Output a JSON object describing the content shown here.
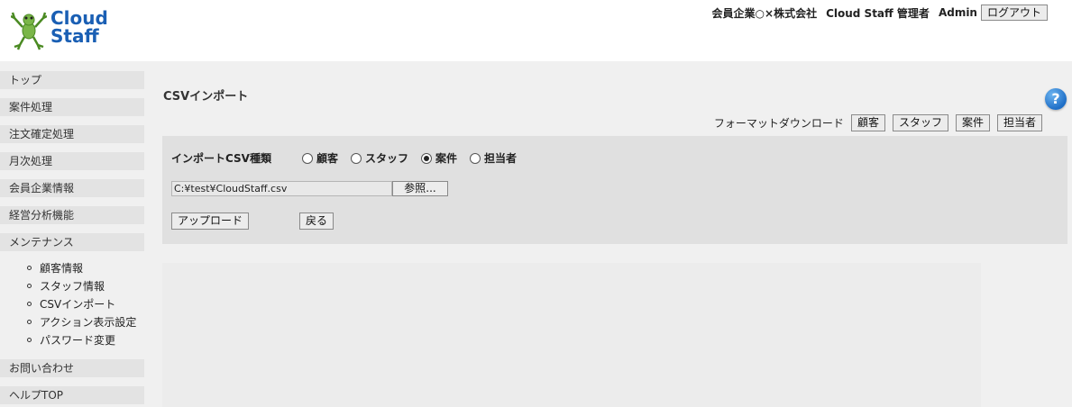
{
  "header": {
    "logo_text_line1": "Cloud",
    "logo_text_line2": "Staff",
    "company": "会員企業○×株式会社",
    "user_role": "Cloud Staff 管理者",
    "user_name": "Admin",
    "logout_label": "ログアウト"
  },
  "sidebar": {
    "items": [
      {
        "label": "トップ"
      },
      {
        "label": "案件処理"
      },
      {
        "label": "注文確定処理"
      },
      {
        "label": "月次処理"
      },
      {
        "label": "会員企業情報"
      },
      {
        "label": "経営分析機能"
      },
      {
        "label": "メンテナンス"
      },
      {
        "label": "お問い合わせ"
      },
      {
        "label": "ヘルプTOP"
      }
    ],
    "sub_items": [
      {
        "label": "顧客情報"
      },
      {
        "label": "スタッフ情報"
      },
      {
        "label": "CSVインポート"
      },
      {
        "label": "アクション表示設定"
      },
      {
        "label": "パスワード変更"
      }
    ]
  },
  "main": {
    "title": "CSVインポート",
    "help_glyph": "?",
    "format_download": {
      "label": "フォーマットダウンロード",
      "buttons": [
        "顧客",
        "スタッフ",
        "案件",
        "担当者"
      ]
    },
    "import_type": {
      "label": "インポートCSV種類",
      "options": [
        "顧客",
        "スタッフ",
        "案件",
        "担当者"
      ],
      "selected": "案件"
    },
    "file": {
      "value": "C:¥test¥CloudStaff.csv",
      "browse_label": "参照..."
    },
    "upload_label": "アップロード",
    "back_label": "戻る"
  },
  "colors": {
    "background": "#f0f0f0",
    "nav_item_bg": "#e3e3e3",
    "panel_bg": "#e0e0e0",
    "logo_blue": "#1a5fb4",
    "help_blue": "#1f6fc7"
  }
}
